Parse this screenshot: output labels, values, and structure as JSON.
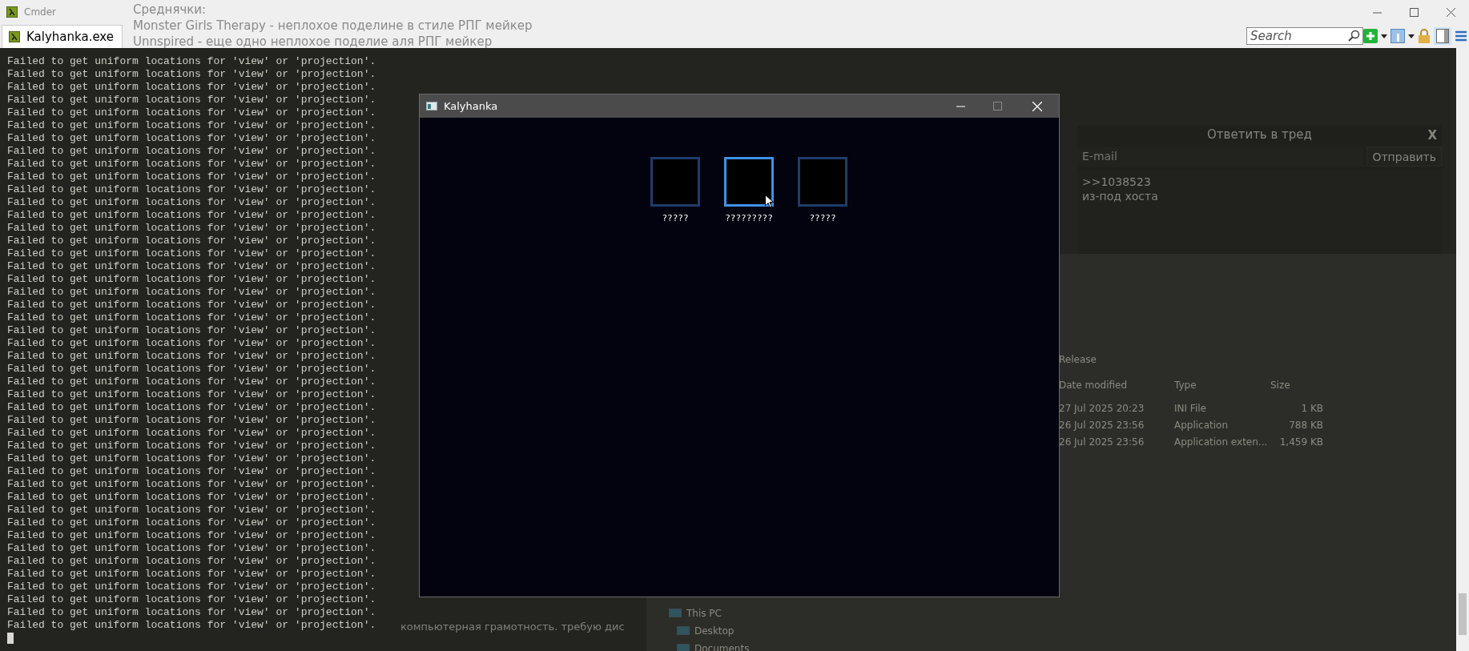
{
  "window": {
    "title": "Cmder",
    "tabs": [
      {
        "label": "Kalyhanka.exe",
        "selected": true
      }
    ],
    "search": {
      "placeholder": "Search"
    }
  },
  "background_title_lines": [
    "Среднячки:",
    "Monster Girls Therapy - неплохое поделине в стиле РПГ мейкер",
    "Unnspired - еще одно неплохое поделие аля РПГ мейкер"
  ],
  "console": {
    "lines": [
      "Failed to get uniform locations for 'view' or 'projection'.",
      "Failed to get uniform locations for 'view' or 'projection'.",
      "Failed to get uniform locations for 'view' or 'projection'.",
      "Failed to get uniform locations for 'view' or 'projection'.",
      "Failed to get uniform locations for 'view' or 'projection'.",
      "Failed to get uniform locations for 'view' or 'projection'.",
      "Failed to get uniform locations for 'view' or 'projection'.",
      "Failed to get uniform locations for 'view' or 'projection'.",
      "Failed to get uniform locations for 'view' or 'projection'.",
      "Failed to get uniform locations for 'view' or 'projection'.",
      "Failed to get uniform locations for 'view' or 'projection'.",
      "Failed to get uniform locations for 'view' or 'projection'.",
      "Failed to get uniform locations for 'view' or 'projection'.",
      "Failed to get uniform locations for 'view' or 'projection'.",
      "Failed to get uniform locations for 'view' or 'projection'.",
      "Failed to get uniform locations for 'view' or 'projection'.",
      "Failed to get uniform locations for 'view' or 'projection'.",
      "Failed to get uniform locations for 'view' or 'projection'.",
      "Failed to get uniform locations for 'view' or 'projection'.",
      "Failed to get uniform locations for 'view' or 'projection'.",
      "Failed to get uniform locations for 'view' or 'projection'.",
      "Failed to get uniform locations for 'view' or 'projection'.",
      "Failed to get uniform locations for 'view' or 'projection'.",
      "Failed to get uniform locations for 'view' or 'projection'.",
      "Failed to get uniform locations for 'view' or 'projection'.",
      "Failed to get uniform locations for 'view' or 'projection'.",
      "Failed to get uniform locations for 'view' or 'projection'.",
      "Failed to get uniform locations for 'view' or 'projection'.",
      "Failed to get uniform locations for 'view' or 'projection'.",
      "Failed to get uniform locations for 'view' or 'projection'.",
      "Failed to get uniform locations for 'view' or 'projection'.",
      "Failed to get uniform locations for 'view' or 'projection'.",
      "Failed to get uniform locations for 'view' or 'projection'.",
      "Failed to get uniform locations for 'view' or 'projection'.",
      "Failed to get uniform locations for 'view' or 'projection'.",
      "Failed to get uniform locations for 'view' or 'projection'.",
      "Failed to get uniform locations for 'view' or 'projection'.",
      "Failed to get uniform locations for 'view' or 'projection'.",
      "Failed to get uniform locations for 'view' or 'projection'.",
      "Failed to get uniform locations for 'view' or 'projection'.",
      "Failed to get uniform locations for 'view' or 'projection'.",
      "Failed to get uniform locations for 'view' or 'projection'.",
      "Failed to get uniform locations for 'view' or 'projection'.",
      "Failed to get uniform locations for 'view' or 'projection'.",
      "Failed to get uniform locations for 'view' or 'projection'."
    ]
  },
  "game_window": {
    "title": "Kalyhanka",
    "slots": [
      {
        "label": "?????",
        "selected": false
      },
      {
        "label": "?????????",
        "selected": true
      },
      {
        "label": "?????",
        "selected": false
      }
    ]
  },
  "reply_form": {
    "title": "Ответить в тред",
    "close": "X",
    "email_placeholder": "E-mail",
    "send": "Отправить",
    "message_lines": [
      ">>1038523",
      "из-под хоста"
    ]
  },
  "explorer": {
    "folder": "Release",
    "columns": [
      "Date modified",
      "Type",
      "Size"
    ],
    "rows": [
      {
        "date": "27 Jul 2025 20:23",
        "type": "INI File",
        "size": "1 KB"
      },
      {
        "date": "26 Jul 2025 23:56",
        "type": "Application",
        "size": "788 KB"
      },
      {
        "date": "26 Jul 2025 23:56",
        "type": "Application exten...",
        "size": "1,459 KB"
      }
    ],
    "nav": [
      "This PC",
      "Desktop",
      "Documents"
    ]
  },
  "background_fragment": "компьютерная грамотность. требую дис"
}
